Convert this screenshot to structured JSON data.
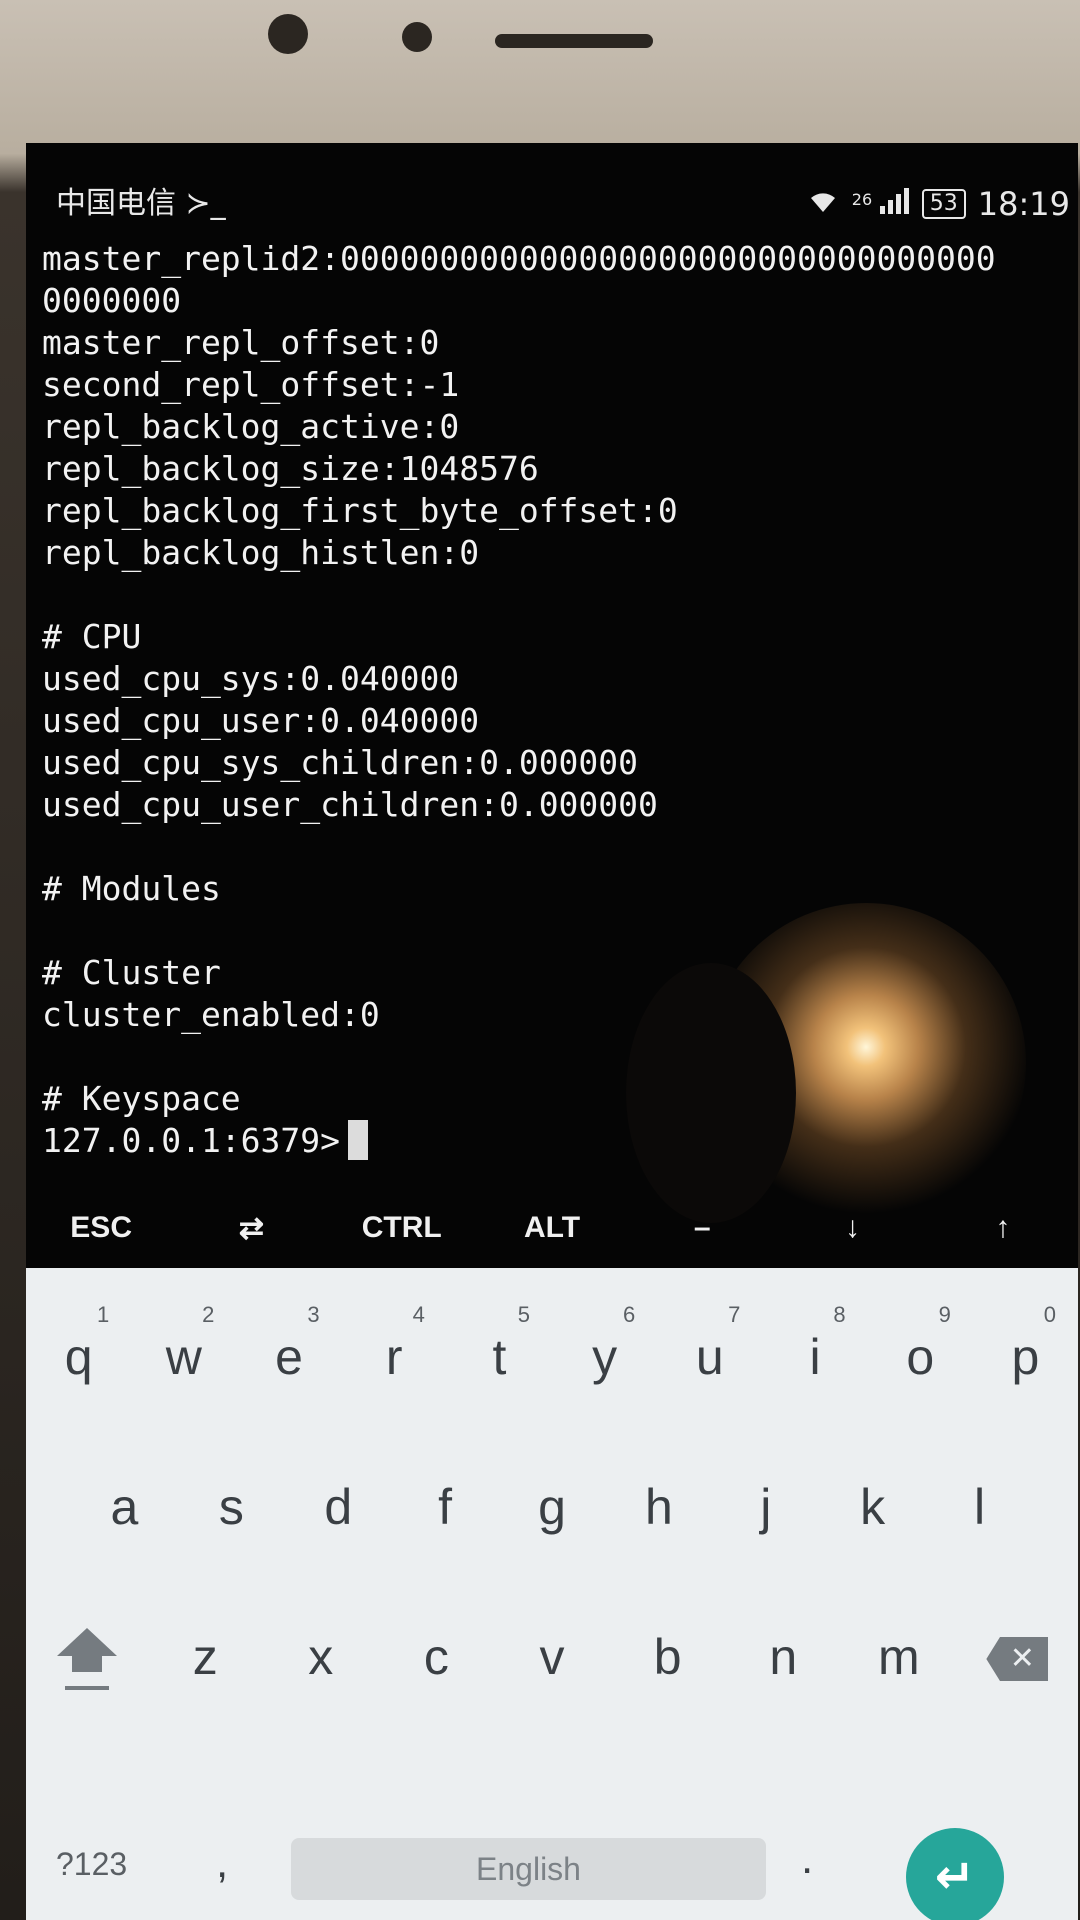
{
  "status_bar": {
    "carrier": "中国电信 ≻_",
    "signal_label": "26",
    "battery": "53",
    "time": "18:19"
  },
  "terminal": {
    "lines": [
      "master_replid2:000000000000000000000000000000000",
      "0000000",
      "master_repl_offset:0",
      "second_repl_offset:-1",
      "repl_backlog_active:0",
      "repl_backlog_size:1048576",
      "repl_backlog_first_byte_offset:0",
      "repl_backlog_histlen:0",
      "",
      "# CPU",
      "used_cpu_sys:0.040000",
      "used_cpu_user:0.040000",
      "used_cpu_sys_children:0.000000",
      "used_cpu_user_children:0.000000",
      "",
      "# Modules",
      "",
      "# Cluster",
      "cluster_enabled:0",
      "",
      "# Keyspace"
    ],
    "prompt": "127.0.0.1:6379>"
  },
  "extra_keys": [
    "ESC",
    "⇄",
    "CTRL",
    "ALT",
    "–",
    "↓",
    "↑"
  ],
  "keyboard": {
    "row1": [
      {
        "ch": "q",
        "hint": "1"
      },
      {
        "ch": "w",
        "hint": "2"
      },
      {
        "ch": "e",
        "hint": "3"
      },
      {
        "ch": "r",
        "hint": "4"
      },
      {
        "ch": "t",
        "hint": "5"
      },
      {
        "ch": "y",
        "hint": "6"
      },
      {
        "ch": "u",
        "hint": "7"
      },
      {
        "ch": "i",
        "hint": "8"
      },
      {
        "ch": "o",
        "hint": "9"
      },
      {
        "ch": "p",
        "hint": "0"
      }
    ],
    "row2": [
      "a",
      "s",
      "d",
      "f",
      "g",
      "h",
      "j",
      "k",
      "l"
    ],
    "row3": [
      "z",
      "x",
      "c",
      "v",
      "b",
      "n",
      "m"
    ],
    "symbols_label": "?123",
    "comma": ",",
    "space_label": "English",
    "period": ".",
    "enter_glyph": "↵",
    "delete_glyph": "✕"
  }
}
